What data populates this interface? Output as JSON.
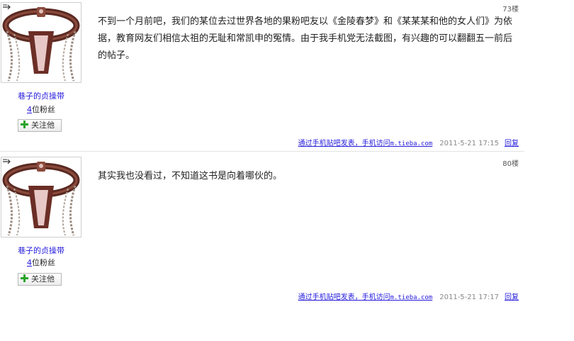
{
  "posts": [
    {
      "floor": "73楼",
      "user": {
        "name": "巷子的贞操带",
        "fans_count": "4",
        "fans_suffix": "位粉丝",
        "follow_label": "关注他"
      },
      "content": "不到一个月前吧，我们的某位去过世界各地的果粉吧友以《金陵春梦》和《某某某和他的女人们》为依据，教育网友们相信太祖的无耻和常凯申的冤情。由于我手机党无法截图，有兴趣的可以翻翻五一前后的帖子。",
      "via_text": "通过手机贴吧发表，手机访问",
      "via_site": "m.tieba.com",
      "time": "2011-5-21 17:15",
      "reply_label": "回复"
    },
    {
      "floor": "80楼",
      "user": {
        "name": "巷子的贞操带",
        "fans_count": "4",
        "fans_suffix": "位粉丝",
        "follow_label": "关注他"
      },
      "content": "其实我也没看过，不知道这书是向着哪伙的。",
      "via_text": "通过手机贴吧发表，手机访问",
      "via_site": "m.tieba.com",
      "time": "2011-5-21 17:17",
      "reply_label": "回复"
    }
  ],
  "colors": {
    "link": "#261cdc",
    "meta_gray": "#888888",
    "plus_green": "#2aa32a"
  }
}
